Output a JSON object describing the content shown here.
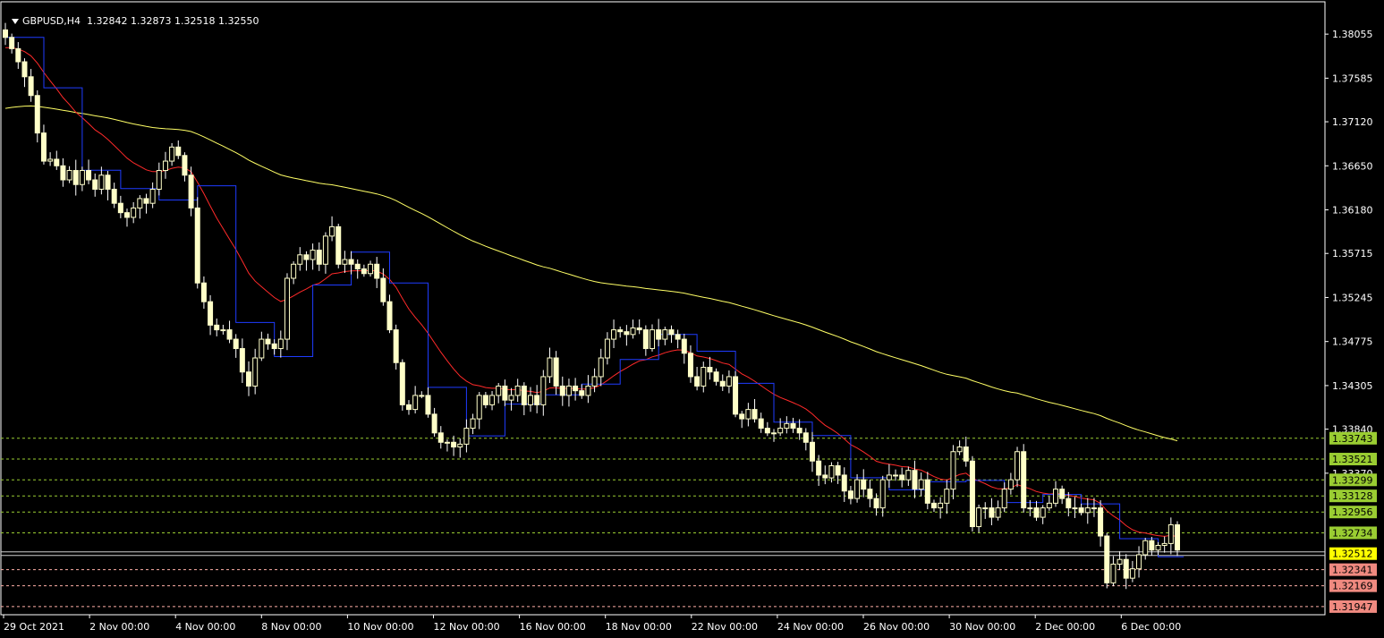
{
  "header": {
    "symbol": "GBPUSD,H4",
    "open": "1.32842",
    "high": "1.32873",
    "low": "1.32518",
    "close": "1.32550"
  },
  "colors": {
    "background": "#000000",
    "candle": "#ffffc8",
    "wick": "#ffffff",
    "grid": "#ffffff",
    "ma_fast": "#ff2a2a",
    "ma_slow": "#ffff66",
    "step": "#1f3cff",
    "level_support": "#ffb0a8",
    "level_resist": "#9acd32",
    "level_current": "#ffff00"
  },
  "chart_data": {
    "type": "candlestick",
    "symbol": "GBPUSD",
    "timeframe": "H4",
    "ylim": [
      1.3186,
      1.384
    ],
    "price_axis_ticks": [
      "1.38055",
      "1.37585",
      "1.37120",
      "1.36650",
      "1.36180",
      "1.35715",
      "1.35245",
      "1.34775",
      "1.34305",
      "1.33840",
      "1.33370"
    ],
    "time_labels": [
      "29 Oct 2021",
      "2 Nov 00:00",
      "4 Nov 00:00",
      "8 Nov 00:00",
      "10 Nov 00:00",
      "12 Nov 00:00",
      "16 Nov 00:00",
      "18 Nov 00:00",
      "22 Nov 00:00",
      "24 Nov 00:00",
      "26 Nov 00:00",
      "30 Nov 00:00",
      "2 Dec 00:00",
      "6 Dec 00:00"
    ],
    "levels": [
      {
        "label": "1.33743",
        "value": 1.33743,
        "type": "resistance"
      },
      {
        "label": "1.33521",
        "value": 1.33521,
        "type": "resistance"
      },
      {
        "label": "1.33299",
        "value": 1.33299,
        "type": "resistance"
      },
      {
        "label": "1.33128",
        "value": 1.33128,
        "type": "resistance"
      },
      {
        "label": "1.32956",
        "value": 1.32956,
        "type": "resistance"
      },
      {
        "label": "1.32734",
        "value": 1.32734,
        "type": "resistance"
      },
      {
        "label": "1.32512",
        "value": 1.32512,
        "type": "current"
      },
      {
        "label": "1.32341",
        "value": 1.32341,
        "type": "support"
      },
      {
        "label": "1.32169",
        "value": 1.32169,
        "type": "support"
      },
      {
        "label": "1.31947",
        "value": 1.31947,
        "type": "support"
      }
    ],
    "candle_closes": [
      1.3802,
      1.379,
      1.3776,
      1.376,
      1.374,
      1.37,
      1.367,
      1.3672,
      1.3665,
      1.365,
      1.366,
      1.3645,
      1.366,
      1.365,
      1.364,
      1.3655,
      1.364,
      1.3625,
      1.3615,
      1.361,
      1.362,
      1.363,
      1.3625,
      1.364,
      1.366,
      1.367,
      1.3685,
      1.3676,
      1.3655,
      1.362,
      1.354,
      1.352,
      1.3495,
      1.349,
      1.349,
      1.348,
      1.347,
      1.3445,
      1.343,
      1.346,
      1.348,
      1.3475,
      1.347,
      1.348,
      1.3545,
      1.356,
      1.357,
      1.3565,
      1.3575,
      1.356,
      1.359,
      1.36,
      1.356,
      1.3565,
      1.356,
      1.3555,
      1.355,
      1.356,
      1.3545,
      1.352,
      1.349,
      1.3455,
      1.341,
      1.3405,
      1.342,
      1.342,
      1.34,
      1.338,
      1.337,
      1.337,
      1.3365,
      1.3368,
      1.3385,
      1.3395,
      1.342,
      1.341,
      1.342,
      1.343,
      1.3415,
      1.342,
      1.343,
      1.341,
      1.342,
      1.341,
      1.344,
      1.346,
      1.343,
      1.342,
      1.343,
      1.3425,
      1.342,
      1.343,
      1.344,
      1.346,
      1.348,
      1.349,
      1.3488,
      1.3485,
      1.3492,
      1.349,
      1.347,
      1.349,
      1.348,
      1.349,
      1.3485,
      1.348,
      1.3465,
      1.344,
      1.343,
      1.345,
      1.3445,
      1.3435,
      1.343,
      1.344,
      1.34,
      1.3395,
      1.3405,
      1.3395,
      1.3385,
      1.338,
      1.338,
      1.3385,
      1.339,
      1.3385,
      1.338,
      1.337,
      1.335,
      1.3335,
      1.3332,
      1.3345,
      1.3335,
      1.3318,
      1.331,
      1.333,
      1.332,
      1.331,
      1.33,
      1.333,
      1.3335,
      1.3335,
      1.333,
      1.334,
      1.332,
      1.333,
      1.3305,
      1.33,
      1.3305,
      1.332,
      1.336,
      1.3365,
      1.335,
      1.328,
      1.33,
      1.33,
      1.329,
      1.33,
      1.332,
      1.333,
      1.336,
      1.33,
      1.33,
      1.329,
      1.33,
      1.3305,
      1.332,
      1.331,
      1.33,
      1.33,
      1.3295,
      1.33,
      1.33,
      1.327,
      1.322,
      1.324,
      1.3245,
      1.3225,
      1.3235,
      1.325,
      1.3265,
      1.3255,
      1.326,
      1.3262,
      1.3282,
      1.3255
    ]
  }
}
